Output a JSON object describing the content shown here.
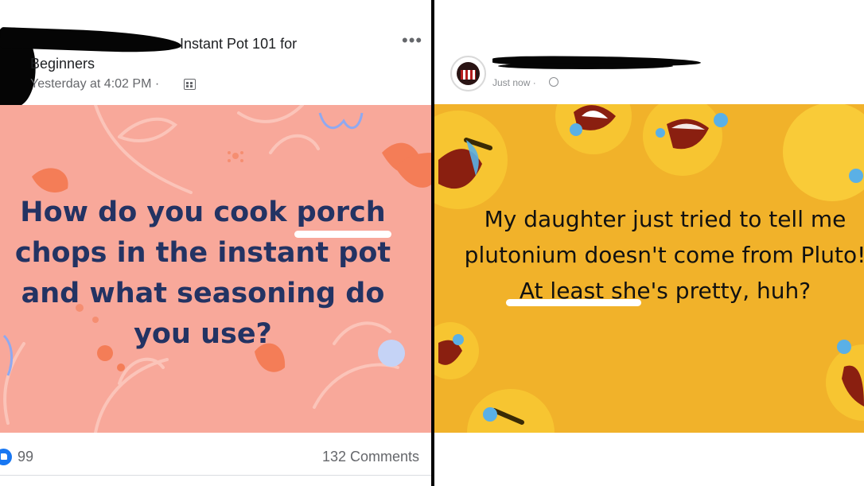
{
  "left_post": {
    "group_name_line1": "Instant Pot 101 for",
    "group_name_line2": "Beginners",
    "timestamp": "Yesterday at 4:02 PM ·",
    "more_label": "•••",
    "post_text": "How do you cook porch chops in the instant pot and what seasoning do you use?",
    "reaction_count": "99",
    "comments": "132 Comments",
    "background_color": "#f8a89a",
    "text_color": "#233363",
    "reaction_icon": "like-icon",
    "audience_icon": "group-audience-icon"
  },
  "right_post": {
    "timestamp": "Just now ·",
    "post_text": "My daughter just tried to tell me plutonium doesn't come from Pluto! At least she's pretty, huh?",
    "background_color": "#f1b22a",
    "text_color": "#111111",
    "audience_icon": "public-globe-icon",
    "background_decoration": "laughing-crying-emoji-pattern"
  },
  "divider_color": "#000000"
}
